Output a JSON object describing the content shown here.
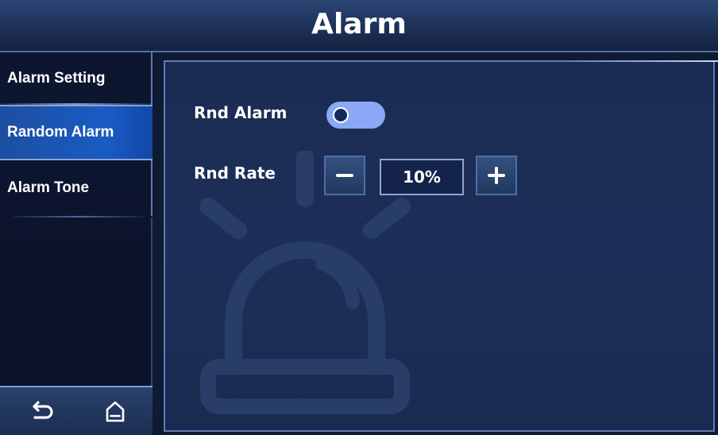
{
  "header": {
    "title": "Alarm"
  },
  "sidebar": {
    "items": [
      {
        "label": "Alarm Setting",
        "active": false
      },
      {
        "label": "Random Alarm",
        "active": true
      },
      {
        "label": "Alarm Tone",
        "active": false
      }
    ],
    "bottom_nav": [
      {
        "icon": "back-arrow-icon"
      },
      {
        "icon": "home-icon"
      }
    ]
  },
  "random_alarm": {
    "enable_label": "Rnd Alarm",
    "enabled": false,
    "rate_label": "Rnd Rate",
    "rate_value": "10%",
    "decrement_icon": "minus-icon",
    "increment_icon": "plus-icon"
  },
  "background_icon": "alarm-beacon-icon",
  "colors": {
    "accent": "#1a5bc4",
    "toggle_track": "#8aa8f6",
    "panel_border": "#5c7cb4"
  }
}
